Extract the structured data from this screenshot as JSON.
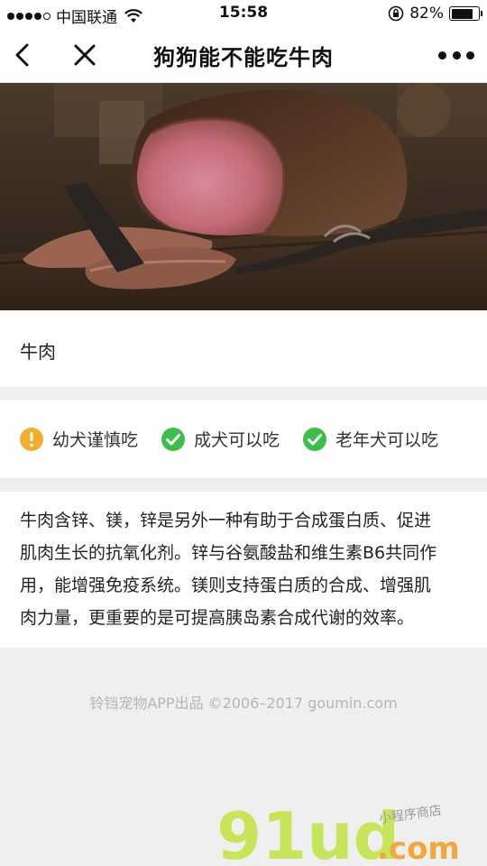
{
  "status_bar": {
    "carrier": "中国联通",
    "time": "15:58",
    "battery": "82%",
    "battery_level": 0.82,
    "signal_strength": 4,
    "signal_max": 5
  },
  "nav": {
    "title": "狗狗能不能吃牛肉",
    "icons": [
      "back-icon",
      "close-icon",
      "more-icon"
    ]
  },
  "food": {
    "name": "牛肉"
  },
  "tags": [
    {
      "label": "幼犬谨慎吃",
      "status": "caution",
      "icon": "warning-icon",
      "color": "#f0ad2e"
    },
    {
      "label": "成犬可以吃",
      "status": "ok",
      "icon": "check-icon",
      "color": "#3cbf4a"
    },
    {
      "label": "老年犬可以吃",
      "status": "ok",
      "icon": "check-icon",
      "color": "#3cbf4a"
    }
  ],
  "description": [
    "牛肉含锌、镁，锌是另外一种有助于合成蛋白质、促进",
    "肌肉生长的抗氧化剂。锌与谷氨酸盐和维生素B6共同作",
    "用，能增强免疫系统。镁则支持蛋白质的合成、增强肌",
    "肉力量，更重要的是可提高胰岛素合成代谢的效率。"
  ],
  "footer": {
    "credit": "铃铛宠物APP出品 ©2006–2017 goumin.com"
  },
  "watermark": {
    "logo_text": "91ud",
    "domain": ".com",
    "tagline": "小程序商店"
  }
}
